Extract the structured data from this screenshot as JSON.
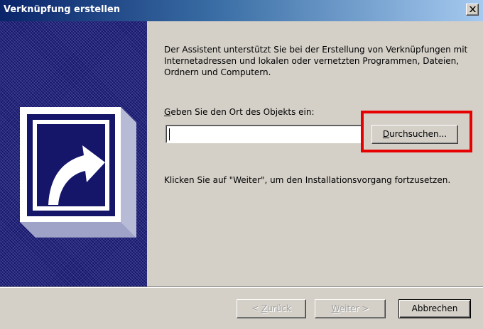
{
  "window": {
    "title": "Verknüpfung erstellen",
    "close_icon": "close-icon"
  },
  "sidebar": {
    "icon": "shortcut-arrow-icon"
  },
  "content": {
    "description": "Der Assistent unterstützt Sie bei der Erstellung von Verknüpfungen mit Internetadressen und lokalen oder vernetzten Programmen, Dateien, Ordnern und Computern.",
    "location_label": "Geben Sie den Ort des Objekts ein:",
    "location_value": "",
    "browse_label": "Durchsuchen...",
    "continue_text": "Klicken Sie auf \"Weiter\", um den Installationsvorgang fortzusetzen."
  },
  "footer": {
    "back_label": "< Zurück",
    "next_label": "Weiter >",
    "cancel_label": "Abbrechen"
  },
  "colors": {
    "titlebar": "#0a246a",
    "sidebar": "#15156a",
    "highlight": "#e60000",
    "face": "#d4d0c8"
  }
}
